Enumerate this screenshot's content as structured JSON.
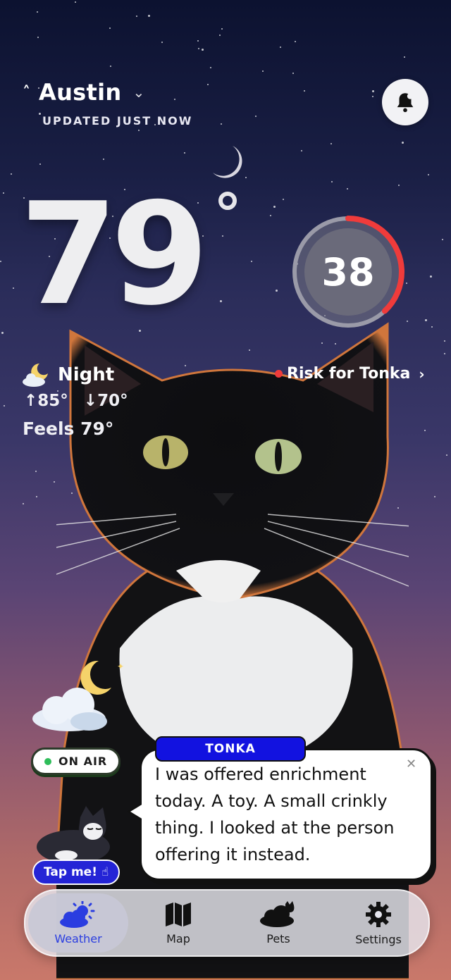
{
  "header": {
    "location_icon": "navigation-arrow-icon",
    "city": "Austin",
    "dropdown_icon": "chevron-down-icon",
    "updated": "UPDATED JUST NOW",
    "alert_icon": "bell-alert-icon"
  },
  "weather": {
    "temperature": "79",
    "condition": "Night",
    "high": "85°",
    "low": "70°",
    "feels": "Feels 79°"
  },
  "risk": {
    "score": "38",
    "score_fraction": 0.38,
    "label": "Risk for Tonka",
    "color": "#ef3b3b"
  },
  "broadcast": {
    "on_air": "ON AIR",
    "tap_me": "Tap me!",
    "speaker": "TONKA",
    "message": "I was offered enrichment today. A toy. A small crinkly thing. I looked at the person offering it instead."
  },
  "tabs": [
    {
      "label": "Weather",
      "icon": "cloud-sun-icon",
      "active": true
    },
    {
      "label": "Map",
      "icon": "map-icon",
      "active": false
    },
    {
      "label": "Pets",
      "icon": "cloud-cat-icon",
      "active": false
    },
    {
      "label": "Settings",
      "icon": "gear-icon",
      "active": false
    }
  ],
  "colors": {
    "accent": "#2a3de0",
    "tag_blue": "#1212e0",
    "on_air_green": "#2fbd5a"
  }
}
